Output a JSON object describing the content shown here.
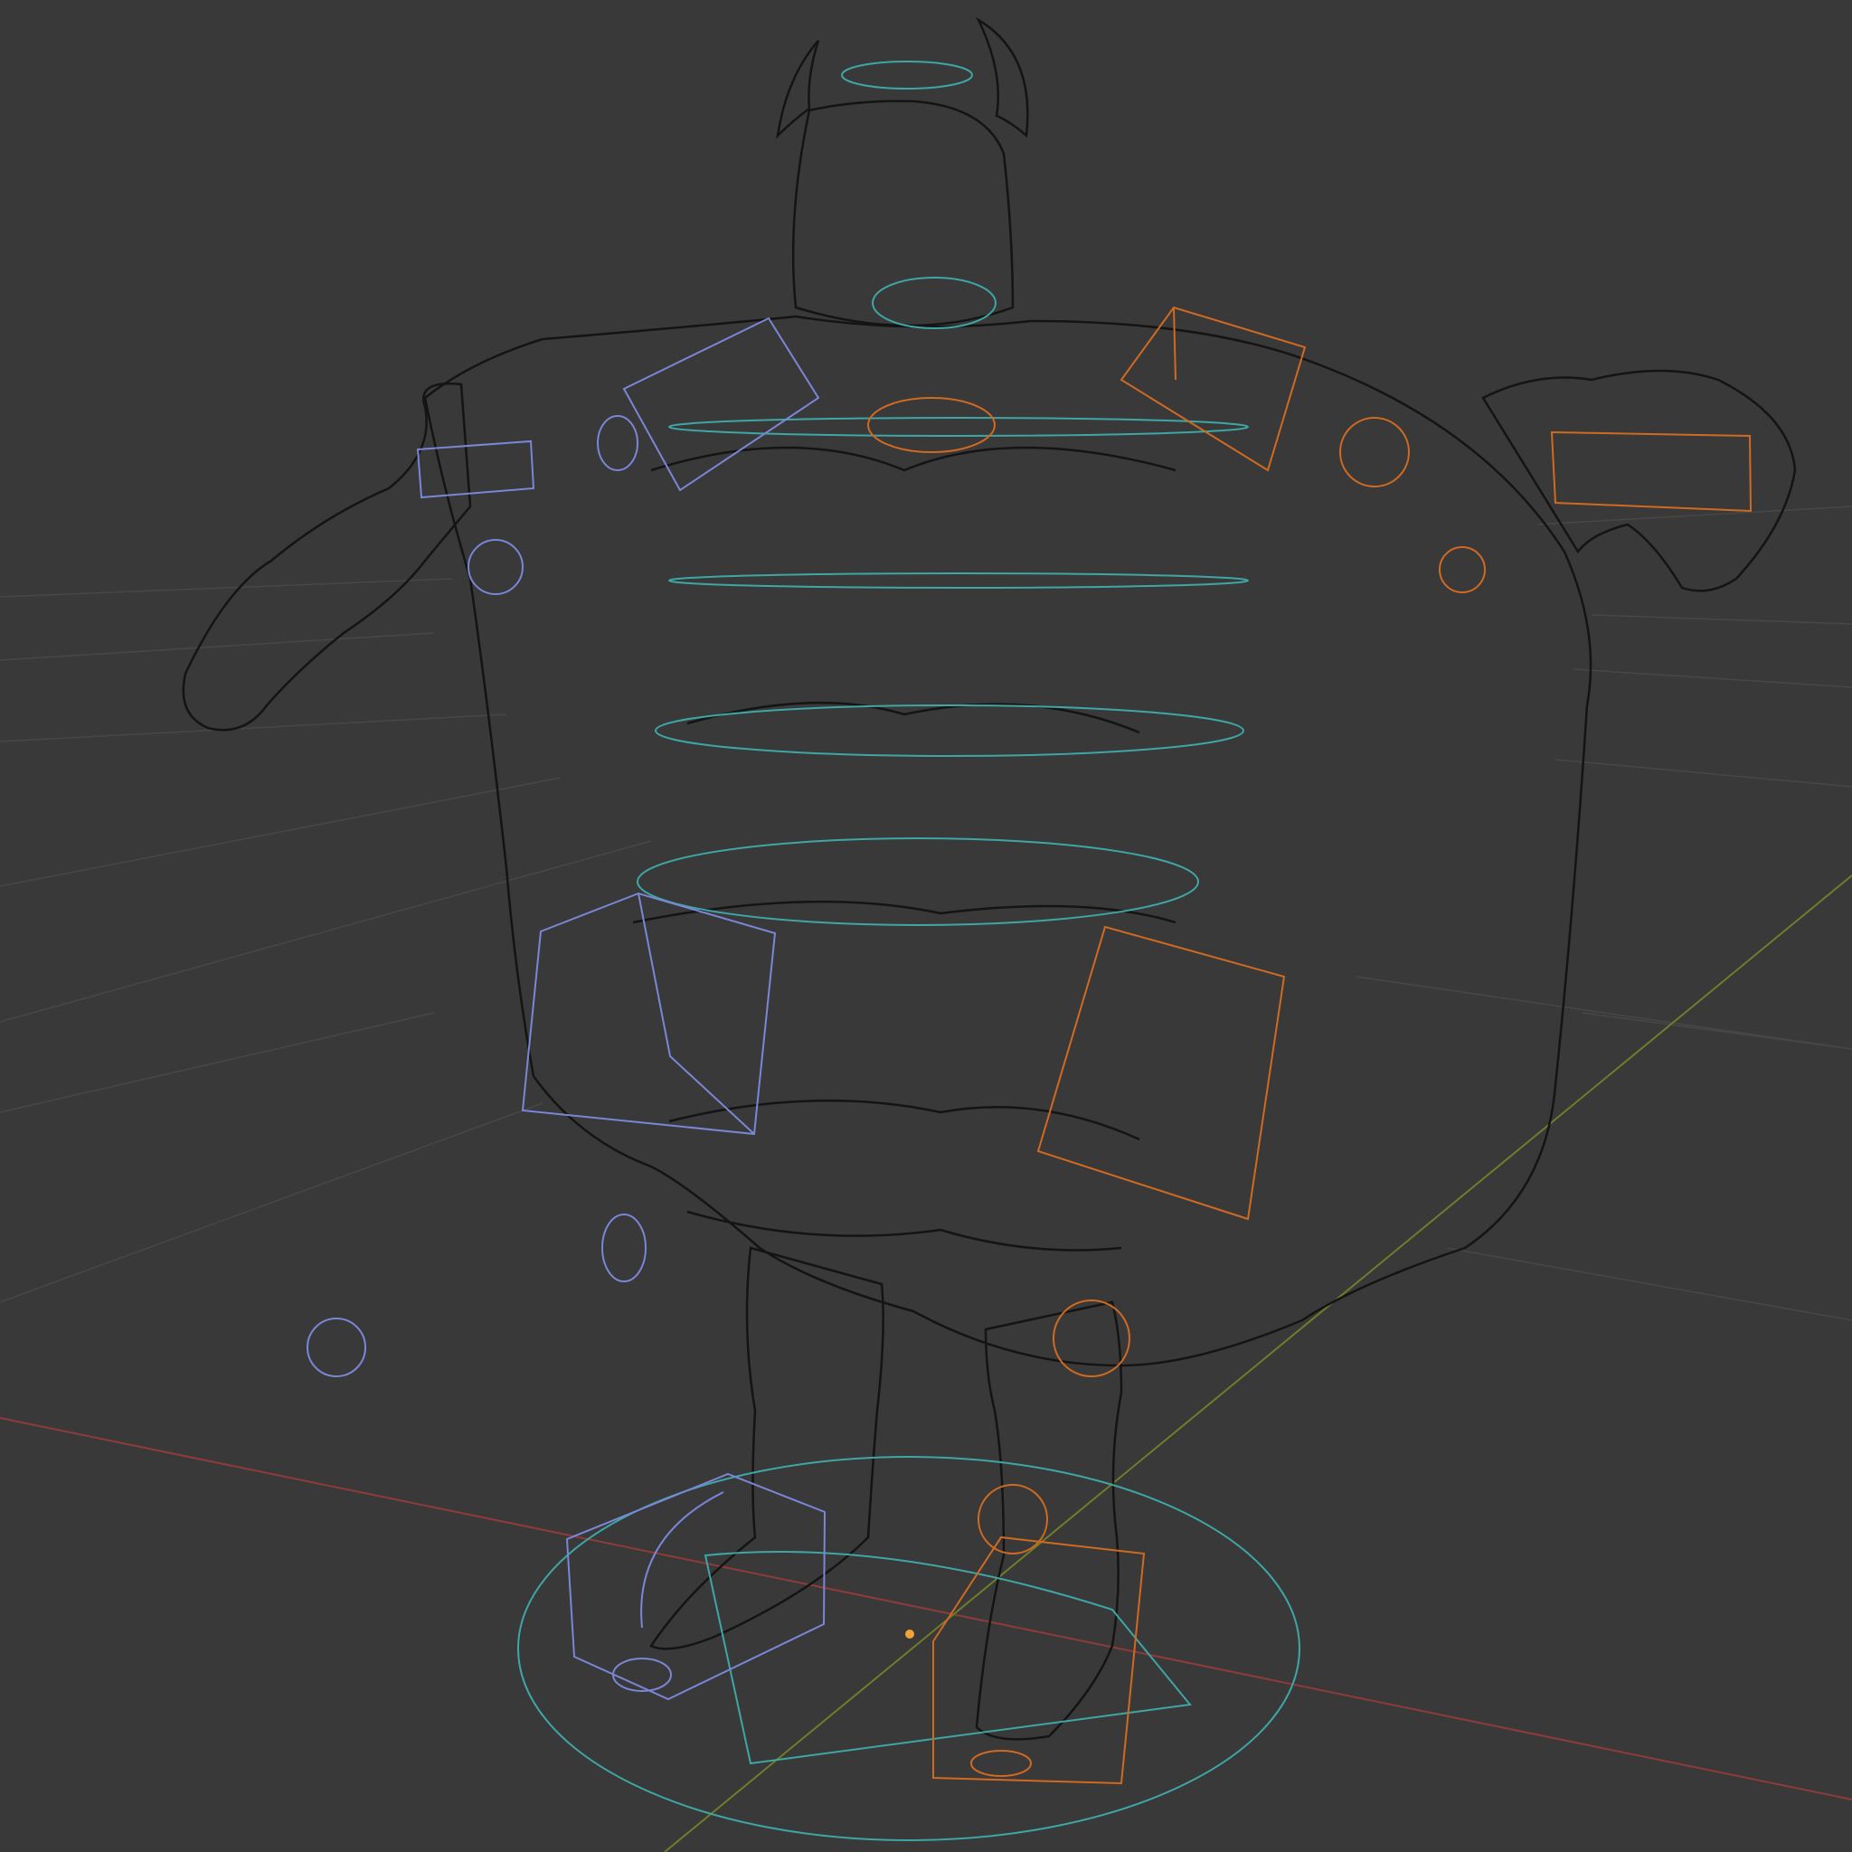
{
  "viewport": {
    "background_color": "#393939",
    "shading_mode": "wireframe",
    "floor_grid": true
  },
  "colors": {
    "grid_line": "#474747",
    "x_axis": "#8f3b3b",
    "y_axis": "#6e7d2a",
    "mesh_wire": "#141414",
    "control_cyan": "#3fa6a6",
    "control_blue": "#7a86d6",
    "control_orange": "#d06a22",
    "origin_marker": "#f3a33a"
  },
  "scene": {
    "character": "horned-ogre-mesh",
    "selected_side": "right",
    "control_groups": [
      "cyan-spine-rings",
      "blue-left-side-controls",
      "orange-right-side-controls",
      "root-circle"
    ]
  }
}
